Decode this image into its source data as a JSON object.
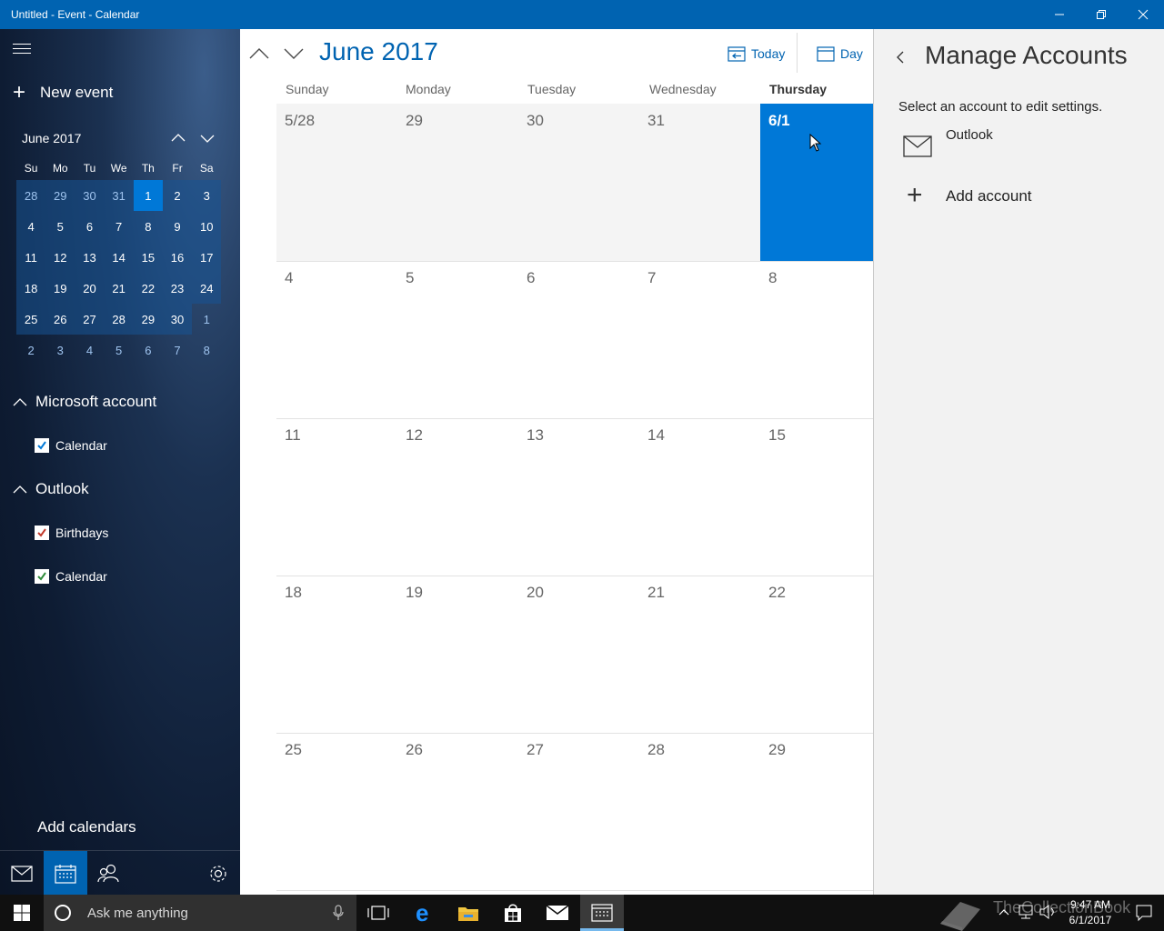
{
  "window": {
    "title": "Untitled - Event - Calendar",
    "title_bar_color": "#0063b1"
  },
  "sidebar": {
    "new_event_label": "New event",
    "mini_calendar": {
      "month_label": "June 2017",
      "weekday_headers": [
        "Su",
        "Mo",
        "Tu",
        "We",
        "Th",
        "Fr",
        "Sa"
      ],
      "weeks": [
        [
          "28",
          "29",
          "30",
          "31",
          "1",
          "2",
          "3"
        ],
        [
          "4",
          "5",
          "6",
          "7",
          "8",
          "9",
          "10"
        ],
        [
          "11",
          "12",
          "13",
          "14",
          "15",
          "16",
          "17"
        ],
        [
          "18",
          "19",
          "20",
          "21",
          "22",
          "23",
          "24"
        ],
        [
          "25",
          "26",
          "27",
          "28",
          "29",
          "30",
          "1"
        ],
        [
          "2",
          "3",
          "4",
          "5",
          "6",
          "7",
          "8"
        ]
      ],
      "selected_day": "1"
    },
    "accounts": [
      {
        "name": "Microsoft account",
        "calendars": [
          {
            "label": "Calendar",
            "color": "#0078d7",
            "checked": true
          }
        ]
      },
      {
        "name": "Outlook",
        "calendars": [
          {
            "label": "Birthdays",
            "color": "#c0392b",
            "checked": true
          },
          {
            "label": "Calendar",
            "color": "#2e8b3a",
            "checked": true
          }
        ]
      }
    ],
    "add_calendars_label": "Add calendars"
  },
  "main": {
    "month_title": "June 2017",
    "today_label": "Today",
    "view_label": "Day",
    "weekdays": [
      "Sunday",
      "Monday",
      "Tuesday",
      "Wednesday",
      "Thursday"
    ],
    "today_column": "Thursday",
    "weeks": [
      [
        "5/28",
        "29",
        "30",
        "31",
        "6/1"
      ],
      [
        "4",
        "5",
        "6",
        "7",
        "8"
      ],
      [
        "11",
        "12",
        "13",
        "14",
        "15"
      ],
      [
        "18",
        "19",
        "20",
        "21",
        "22"
      ],
      [
        "25",
        "26",
        "27",
        "28",
        "29"
      ]
    ],
    "accent_color": "#0078d7"
  },
  "panel": {
    "title": "Manage Accounts",
    "hint": "Select an account to edit settings.",
    "accounts": [
      "Outlook"
    ],
    "add_account_label": "Add account"
  },
  "taskbar": {
    "search_placeholder": "Ask me anything",
    "time": "9:47 AM",
    "date": "6/1/2017",
    "watermark": "TheCollectionBook"
  }
}
